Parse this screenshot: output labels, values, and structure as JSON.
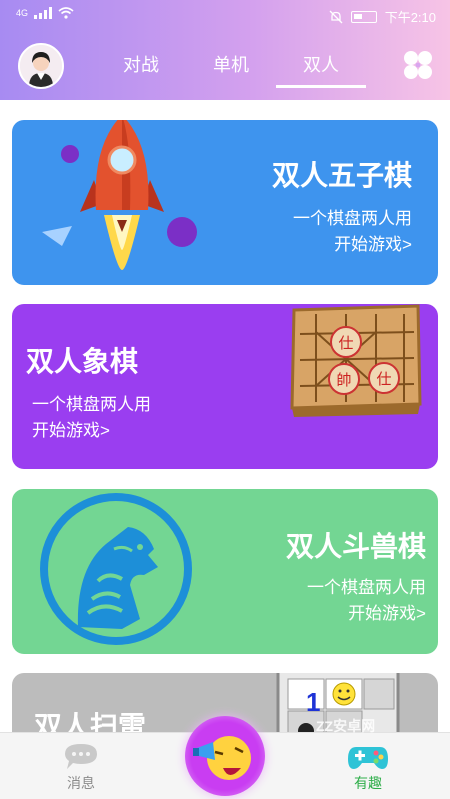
{
  "status_bar": {
    "network": "4G",
    "time": "下午2:10"
  },
  "header": {
    "tabs": [
      {
        "label": "对战",
        "active": false
      },
      {
        "label": "单机",
        "active": false
      },
      {
        "label": "双人",
        "active": true
      }
    ]
  },
  "cards": [
    {
      "title": "双人五子棋",
      "subtitle": "一个棋盘两人用",
      "action": "开始游戏>",
      "color": "#3e94ee",
      "icon": "rocket-icon"
    },
    {
      "title": "双人象棋",
      "subtitle": "一个棋盘两人用",
      "action": "开始游戏>",
      "color": "#9a3ef0",
      "icon": "chess-board-icon"
    },
    {
      "title": "双人斗兽棋",
      "subtitle": "一个棋盘两人用",
      "action": "开始游戏>",
      "color": "#73d693",
      "icon": "tiger-icon"
    },
    {
      "title": "双人扫雷",
      "color": "#bcbcbc",
      "icon": "minesweeper-icon",
      "cell_number": "1"
    }
  ],
  "bottom_nav": {
    "messages_label": "消息",
    "fun_label": "有趣",
    "fun_color": "#2fae4a"
  },
  "watermark": "ZZ安卓网"
}
